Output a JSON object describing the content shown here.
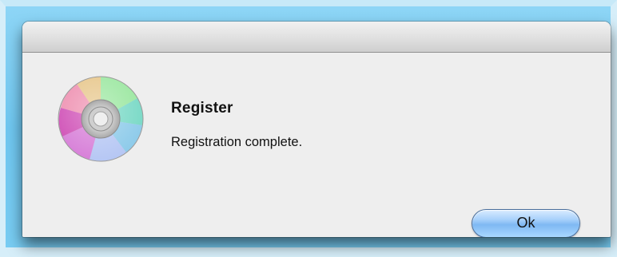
{
  "dialog": {
    "title": "Register",
    "message": "Registration complete.",
    "ok_label": "Ok"
  },
  "icons": {
    "app_icon": "compact-disc-icon"
  },
  "colors": {
    "button_accent": "#7fb8f3",
    "dialog_background": "#eeeeee",
    "backdrop": "#6fc7f0"
  }
}
